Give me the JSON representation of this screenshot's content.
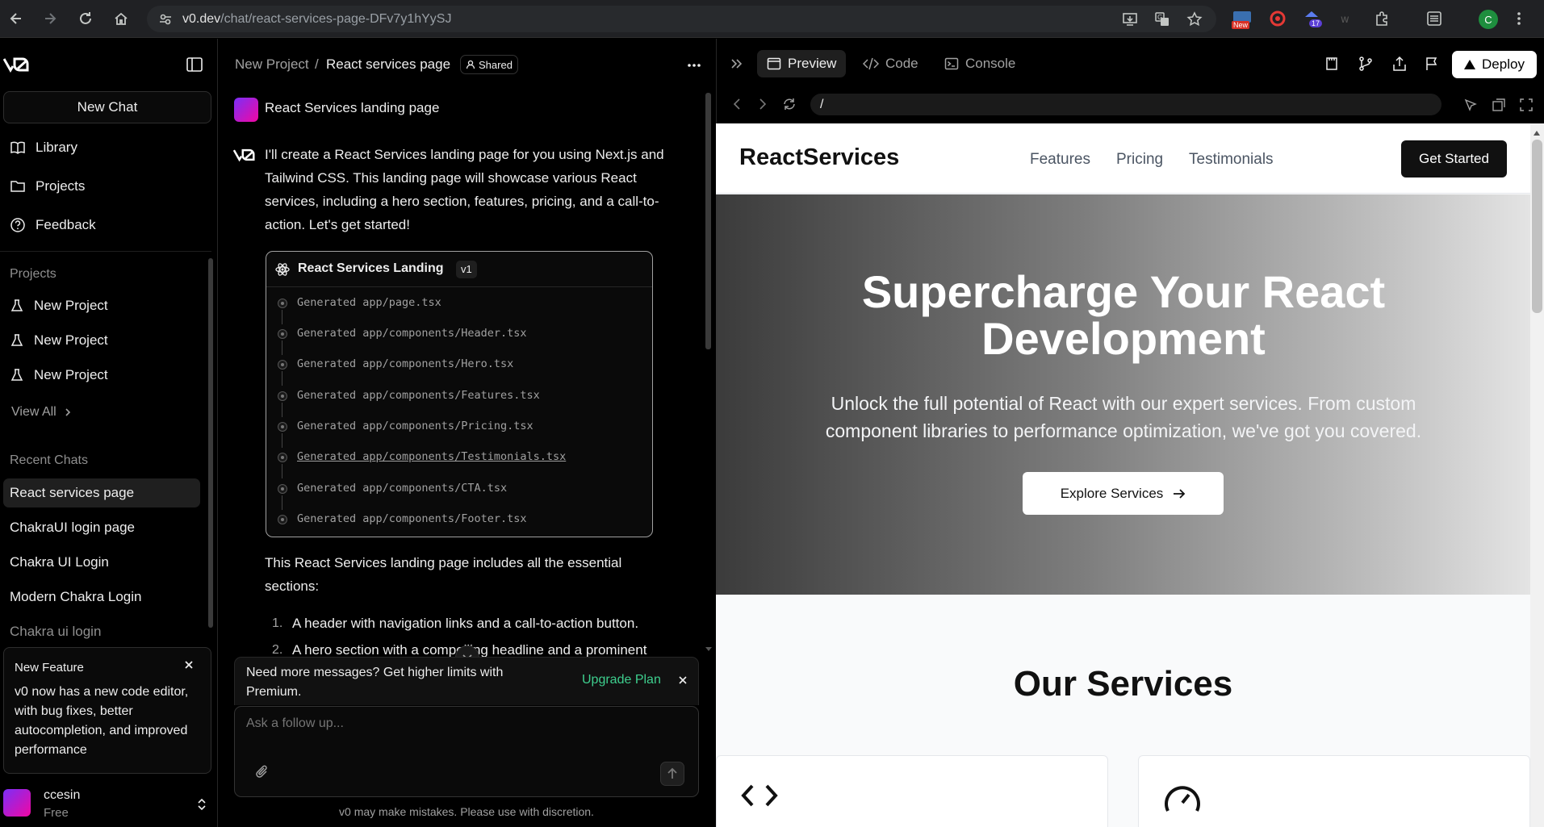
{
  "browser": {
    "url_host": "v0.dev",
    "url_path": "/chat/react-services-page-DFv7y1hYySJ",
    "ext_badge_new": "New",
    "ext_badge_count": "17",
    "profile_initial": "C"
  },
  "sidebar": {
    "new_chat": "New Chat",
    "nav": [
      {
        "label": "Library"
      },
      {
        "label": "Projects"
      },
      {
        "label": "Feedback"
      }
    ],
    "projects_heading": "Projects",
    "projects": [
      {
        "label": "New Project"
      },
      {
        "label": "New Project"
      },
      {
        "label": "New Project"
      }
    ],
    "view_all": "View All",
    "recent_heading": "Recent Chats",
    "recent_chats": [
      {
        "label": "React services page",
        "active": true
      },
      {
        "label": "ChakraUI login page"
      },
      {
        "label": "Chakra UI Login"
      },
      {
        "label": "Modern Chakra Login"
      },
      {
        "label": "Chakra ui login"
      }
    ],
    "feature_card": {
      "title": "New Feature",
      "body": "v0 now has a new code editor, with bug fixes, better autocompletion, and improved performance"
    },
    "user": {
      "name": "ccesin",
      "plan": "Free"
    }
  },
  "chat": {
    "breadcrumb_project": "New Project",
    "breadcrumb_sep": "/",
    "breadcrumb_page": "React services page",
    "shared_badge": "Shared",
    "user_prompt": "React Services landing page",
    "assistant_intro": "I'll create a React Services landing page for you using Next.js and Tailwind CSS. This landing page will showcase various React services, including a hero section, features, pricing, and a call-to-action. Let's get started!",
    "gen_block": {
      "title": "React Services Landing",
      "version": "v1",
      "lines": [
        "Generated app/page.tsx",
        "Generated app/components/Header.tsx",
        "Generated app/components/Hero.tsx",
        "Generated app/components/Features.tsx",
        "Generated app/components/Pricing.tsx",
        "Generated app/components/Testimonials.tsx",
        "Generated app/components/CTA.tsx",
        "Generated app/components/Footer.tsx"
      ]
    },
    "summary": "This React Services landing page includes all the essential sections:",
    "list": [
      {
        "num": "1.",
        "text": "A header with navigation links and a call-to-action button."
      },
      {
        "num": "2.",
        "text": "A hero section with a compelling headline and a prominent"
      }
    ],
    "upgrade_banner": {
      "text": "Need more messages? Get higher limits with Premium.",
      "cta": "Upgrade Plan"
    },
    "input_placeholder": "Ask a follow up...",
    "disclaimer": "v0 may make mistakes. Please use with discretion."
  },
  "preview": {
    "tabs": [
      {
        "label": "Preview",
        "active": true
      },
      {
        "label": "Code"
      },
      {
        "label": "Console"
      }
    ],
    "deploy": "Deploy",
    "route": "/",
    "site": {
      "logo": "ReactServices",
      "nav": [
        "Features",
        "Pricing",
        "Testimonials"
      ],
      "cta": "Get Started",
      "hero_title": "Supercharge Your React Development",
      "hero_sub": "Unlock the full potential of React with our expert services. From custom component libraries to performance optimization, we've got you covered.",
      "hero_btn": "Explore Services",
      "services_title": "Our Services"
    }
  }
}
